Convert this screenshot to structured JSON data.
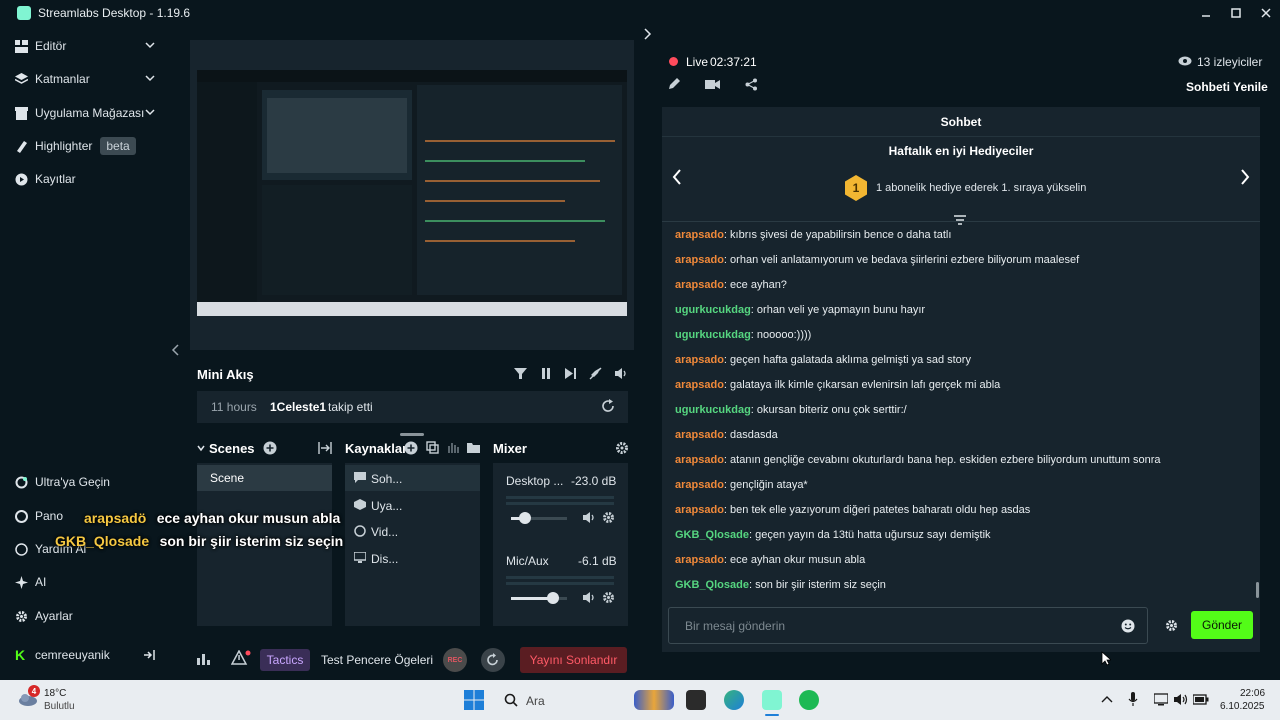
{
  "app": {
    "title": "Streamlabs Desktop - 1.19.6"
  },
  "sidebar": {
    "items": [
      {
        "label": "Editör",
        "icon": "layout-icon"
      },
      {
        "label": "Katmanlar",
        "icon": "layers-icon"
      },
      {
        "label": "Uygulama Mağazası",
        "icon": "store-icon"
      },
      {
        "label": "Highlighter",
        "icon": "highlighter-icon",
        "badge": "beta"
      },
      {
        "label": "Kayıtlar",
        "icon": "recordings-icon"
      }
    ],
    "bottom_items": [
      {
        "label": "Ultra'ya Geçin",
        "icon": "ultra-icon"
      },
      {
        "label": "Pano",
        "icon": "dashboard-icon"
      },
      {
        "label": "Yardım Al",
        "icon": "help-icon"
      },
      {
        "label": "AI",
        "icon": "sparkle-icon"
      },
      {
        "label": "Ayarlar",
        "icon": "gear-icon"
      }
    ],
    "user": {
      "name": "cemreeuyanik"
    }
  },
  "mini_feed": {
    "title": "Mini Akış",
    "time": "11 hours",
    "user": "1Celeste1",
    "action": "takip etti"
  },
  "scenes": {
    "title": "Scenes",
    "items": [
      "Scene"
    ]
  },
  "sources": {
    "title": "Kaynaklar",
    "items": [
      "Soh...",
      "Uya...",
      "Vid...",
      "Dis..."
    ]
  },
  "mixer": {
    "title": "Mixer",
    "channels": [
      {
        "name": "Desktop ...",
        "db": "-23.0 dB",
        "level": 0.25
      },
      {
        "name": "Mic/Aux",
        "db": "-6.1 dB",
        "level": 0.75
      }
    ]
  },
  "footer": {
    "tag": "Tactics",
    "label": "Test Pencere Ögeleri",
    "rec": "REC",
    "end_stream": "Yayını Sonlandır"
  },
  "overlay": [
    {
      "user": "arapsadö",
      "text": "ece ayhan okur musun abla"
    },
    {
      "user": "GKB_Qlosade",
      "text": "son bir şiir isterim siz seçin"
    }
  ],
  "stream": {
    "status": "Live",
    "time": "02:37:21",
    "viewers": "13 izleyiciler",
    "refresh": "Sohbeti Yenile"
  },
  "chat": {
    "title": "Sohbet",
    "gifters_title": "Haftalık en iyi Hediyeciler",
    "gifters_rank": "1",
    "gifters_text": "1 abonelik hediye ederek 1. sıraya yükselin",
    "messages": [
      {
        "user": "arapsado",
        "color": "#f0893a",
        "text": "kıbrıs şivesi de yapabilirsin bence o daha tatlı"
      },
      {
        "user": "arapsado",
        "color": "#f0893a",
        "text": "orhan veli anlatamıyorum ve bedava şiirlerini ezbere biliyorum maalesef"
      },
      {
        "user": "arapsado",
        "color": "#f0893a",
        "text": "ece ayhan?"
      },
      {
        "user": "ugurkucukdag",
        "color": "#56d680",
        "text": "orhan veli ye yapmayın bunu hayır"
      },
      {
        "user": "ugurkucukdag",
        "color": "#56d680",
        "text": "nooooo:))))"
      },
      {
        "user": "arapsado",
        "color": "#f0893a",
        "text": "geçen hafta galatada aklıma gelmişti ya sad story"
      },
      {
        "user": "arapsado",
        "color": "#f0893a",
        "text": "galataya ilk kimle çıkarsan evlenirsin lafı gerçek mi abla"
      },
      {
        "user": "ugurkucukdag",
        "color": "#56d680",
        "text": "okursan biteriz onu çok serttir:/"
      },
      {
        "user": "arapsado",
        "color": "#f0893a",
        "text": "dasdasda"
      },
      {
        "user": "arapsado",
        "color": "#f0893a",
        "text": "atanın gençliğe cevabını okuturlardı bana hep. eskiden ezbere biliyordum unuttum sonra"
      },
      {
        "user": "arapsado",
        "color": "#f0893a",
        "text": "gençliğin ataya*"
      },
      {
        "user": "arapsado",
        "color": "#f0893a",
        "text": "ben tek elle yazıyorum diğeri patetes baharatı oldu hep asdas"
      },
      {
        "user": "GKB_Qlosade",
        "color": "#56d680",
        "text": "geçen yayın da 13tü hatta uğursuz sayı demiştik"
      },
      {
        "user": "arapsado",
        "color": "#f0893a",
        "text": "ece ayhan okur musun abla"
      },
      {
        "user": "GKB_Qlosade",
        "color": "#56d680",
        "text": "son bir şiir isterim siz seçin"
      }
    ],
    "input_placeholder": "Bir mesaj gönderin",
    "send": "Gönder"
  },
  "taskbar": {
    "weather_temp": "18°C",
    "weather_desc": "Bulutlu",
    "weather_badge": "4",
    "search": "Ara",
    "time": "22:06",
    "date": "6.10.2025"
  }
}
